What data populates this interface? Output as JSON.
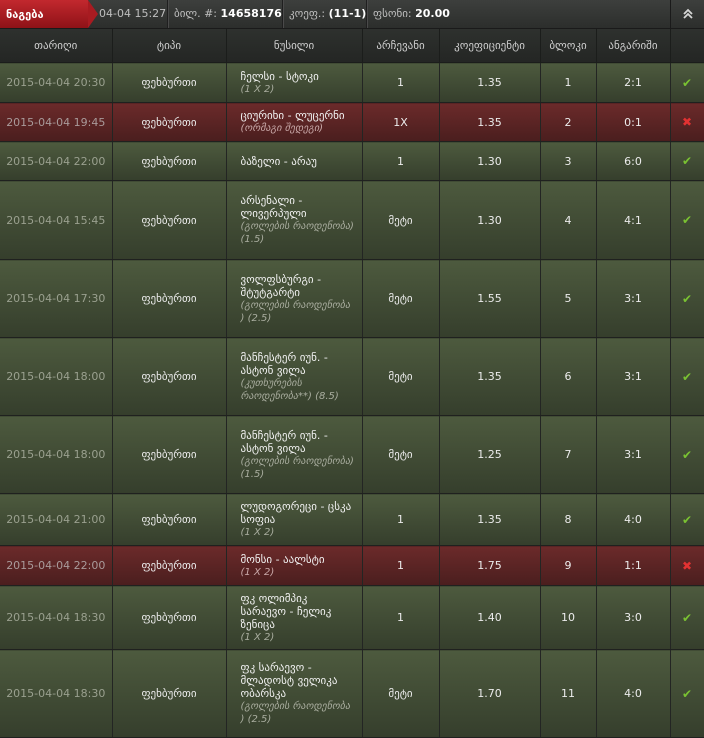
{
  "header": {
    "tag": "ნაგება",
    "datetime": "04-04 15:27",
    "ticket_label": "ბილ. #:",
    "ticket_no": "14658176",
    "coef_label": "კოეფ.:",
    "coef_value": "(11-1)",
    "payout_label": "ფსონი:",
    "payout_value": "20.00",
    "collapse_icon": "double-chevron-up-icon"
  },
  "columns": [
    "თარიღი",
    "ტიპი",
    "ნუსილი",
    "არჩევანი",
    "კოეფიციენტი",
    "ბლოკი",
    "ანგარიში",
    ""
  ],
  "rows": [
    {
      "date": "2015-04-04 20:30",
      "type": "ფეხბურთი",
      "event": "ჩელსი - სტოკი",
      "note": "(1 X 2)",
      "pick": "1",
      "coef": "1.35",
      "block": "1",
      "score": "2:1",
      "status": "win"
    },
    {
      "date": "2015-04-04 19:45",
      "type": "ფეხბურთი",
      "event": "ციურიხი - ლუცერნი",
      "note": "(ორმაგი შედეგი)",
      "pick": "1X",
      "coef": "1.35",
      "block": "2",
      "score": "0:1",
      "status": "loss"
    },
    {
      "date": "2015-04-04 22:00",
      "type": "ფეხბურთი",
      "event": "ბაზელი - არაუ",
      "note": "",
      "pick": "1",
      "coef": "1.30",
      "block": "3",
      "score": "6:0",
      "status": "win"
    },
    {
      "date": "2015-04-04 15:45",
      "type": "ფეხბურთი",
      "event": "არსენალი - ლივერპული",
      "note": "(გოლების რაოდენობა) (1.5)",
      "pick": "მეტი",
      "coef": "1.30",
      "block": "4",
      "score": "4:1",
      "status": "win"
    },
    {
      "date": "2015-04-04 17:30",
      "type": "ფეხბურთი",
      "event": "ვოლფსბურგი - შტუტგარტი",
      "note": "(გოლების რაოდენობა ) (2.5)",
      "pick": "მეტი",
      "coef": "1.55",
      "block": "5",
      "score": "3:1",
      "status": "win"
    },
    {
      "date": "2015-04-04 18:00",
      "type": "ფეხბურთი",
      "event": "მანჩესტერ იუნ. - ასტონ ვილა",
      "note": "(კუთხურების რაოდენობა**) (8.5)",
      "pick": "მეტი",
      "coef": "1.35",
      "block": "6",
      "score": "3:1",
      "status": "win"
    },
    {
      "date": "2015-04-04 18:00",
      "type": "ფეხბურთი",
      "event": "მანჩესტერ იუნ. - ასტონ ვილა",
      "note": "(გოლების რაოდენობა) (1.5)",
      "pick": "მეტი",
      "coef": "1.25",
      "block": "7",
      "score": "3:1",
      "status": "win"
    },
    {
      "date": "2015-04-04 21:00",
      "type": "ფეხბურთი",
      "event": "ლუდოგორეცი - ცსკა სოფია",
      "note": "(1 X 2)",
      "pick": "1",
      "coef": "1.35",
      "block": "8",
      "score": "4:0",
      "status": "win"
    },
    {
      "date": "2015-04-04 22:00",
      "type": "ფეხბურთი",
      "event": "მონსი - აალსტი",
      "note": "(1 X 2)",
      "pick": "1",
      "coef": "1.75",
      "block": "9",
      "score": "1:1",
      "status": "loss"
    },
    {
      "date": "2015-04-04 18:30",
      "type": "ფეხბურთი",
      "event": "ფკ ოლიმპიკ სარაევო - ჩელიკ ზენიცა",
      "note": "(1 X 2)",
      "pick": "1",
      "coef": "1.40",
      "block": "10",
      "score": "3:0",
      "status": "win"
    },
    {
      "date": "2015-04-04 18:30",
      "type": "ფეხბურთი",
      "event": "ფკ სარაევო - მლადოსტ ველიკა ობარსკა",
      "note": "(გოლების რაოდენობა ) (2.5)",
      "pick": "მეტი",
      "coef": "1.70",
      "block": "11",
      "score": "4:0",
      "status": "win"
    }
  ],
  "status_icons": {
    "win": "✔",
    "loss": "✖"
  }
}
